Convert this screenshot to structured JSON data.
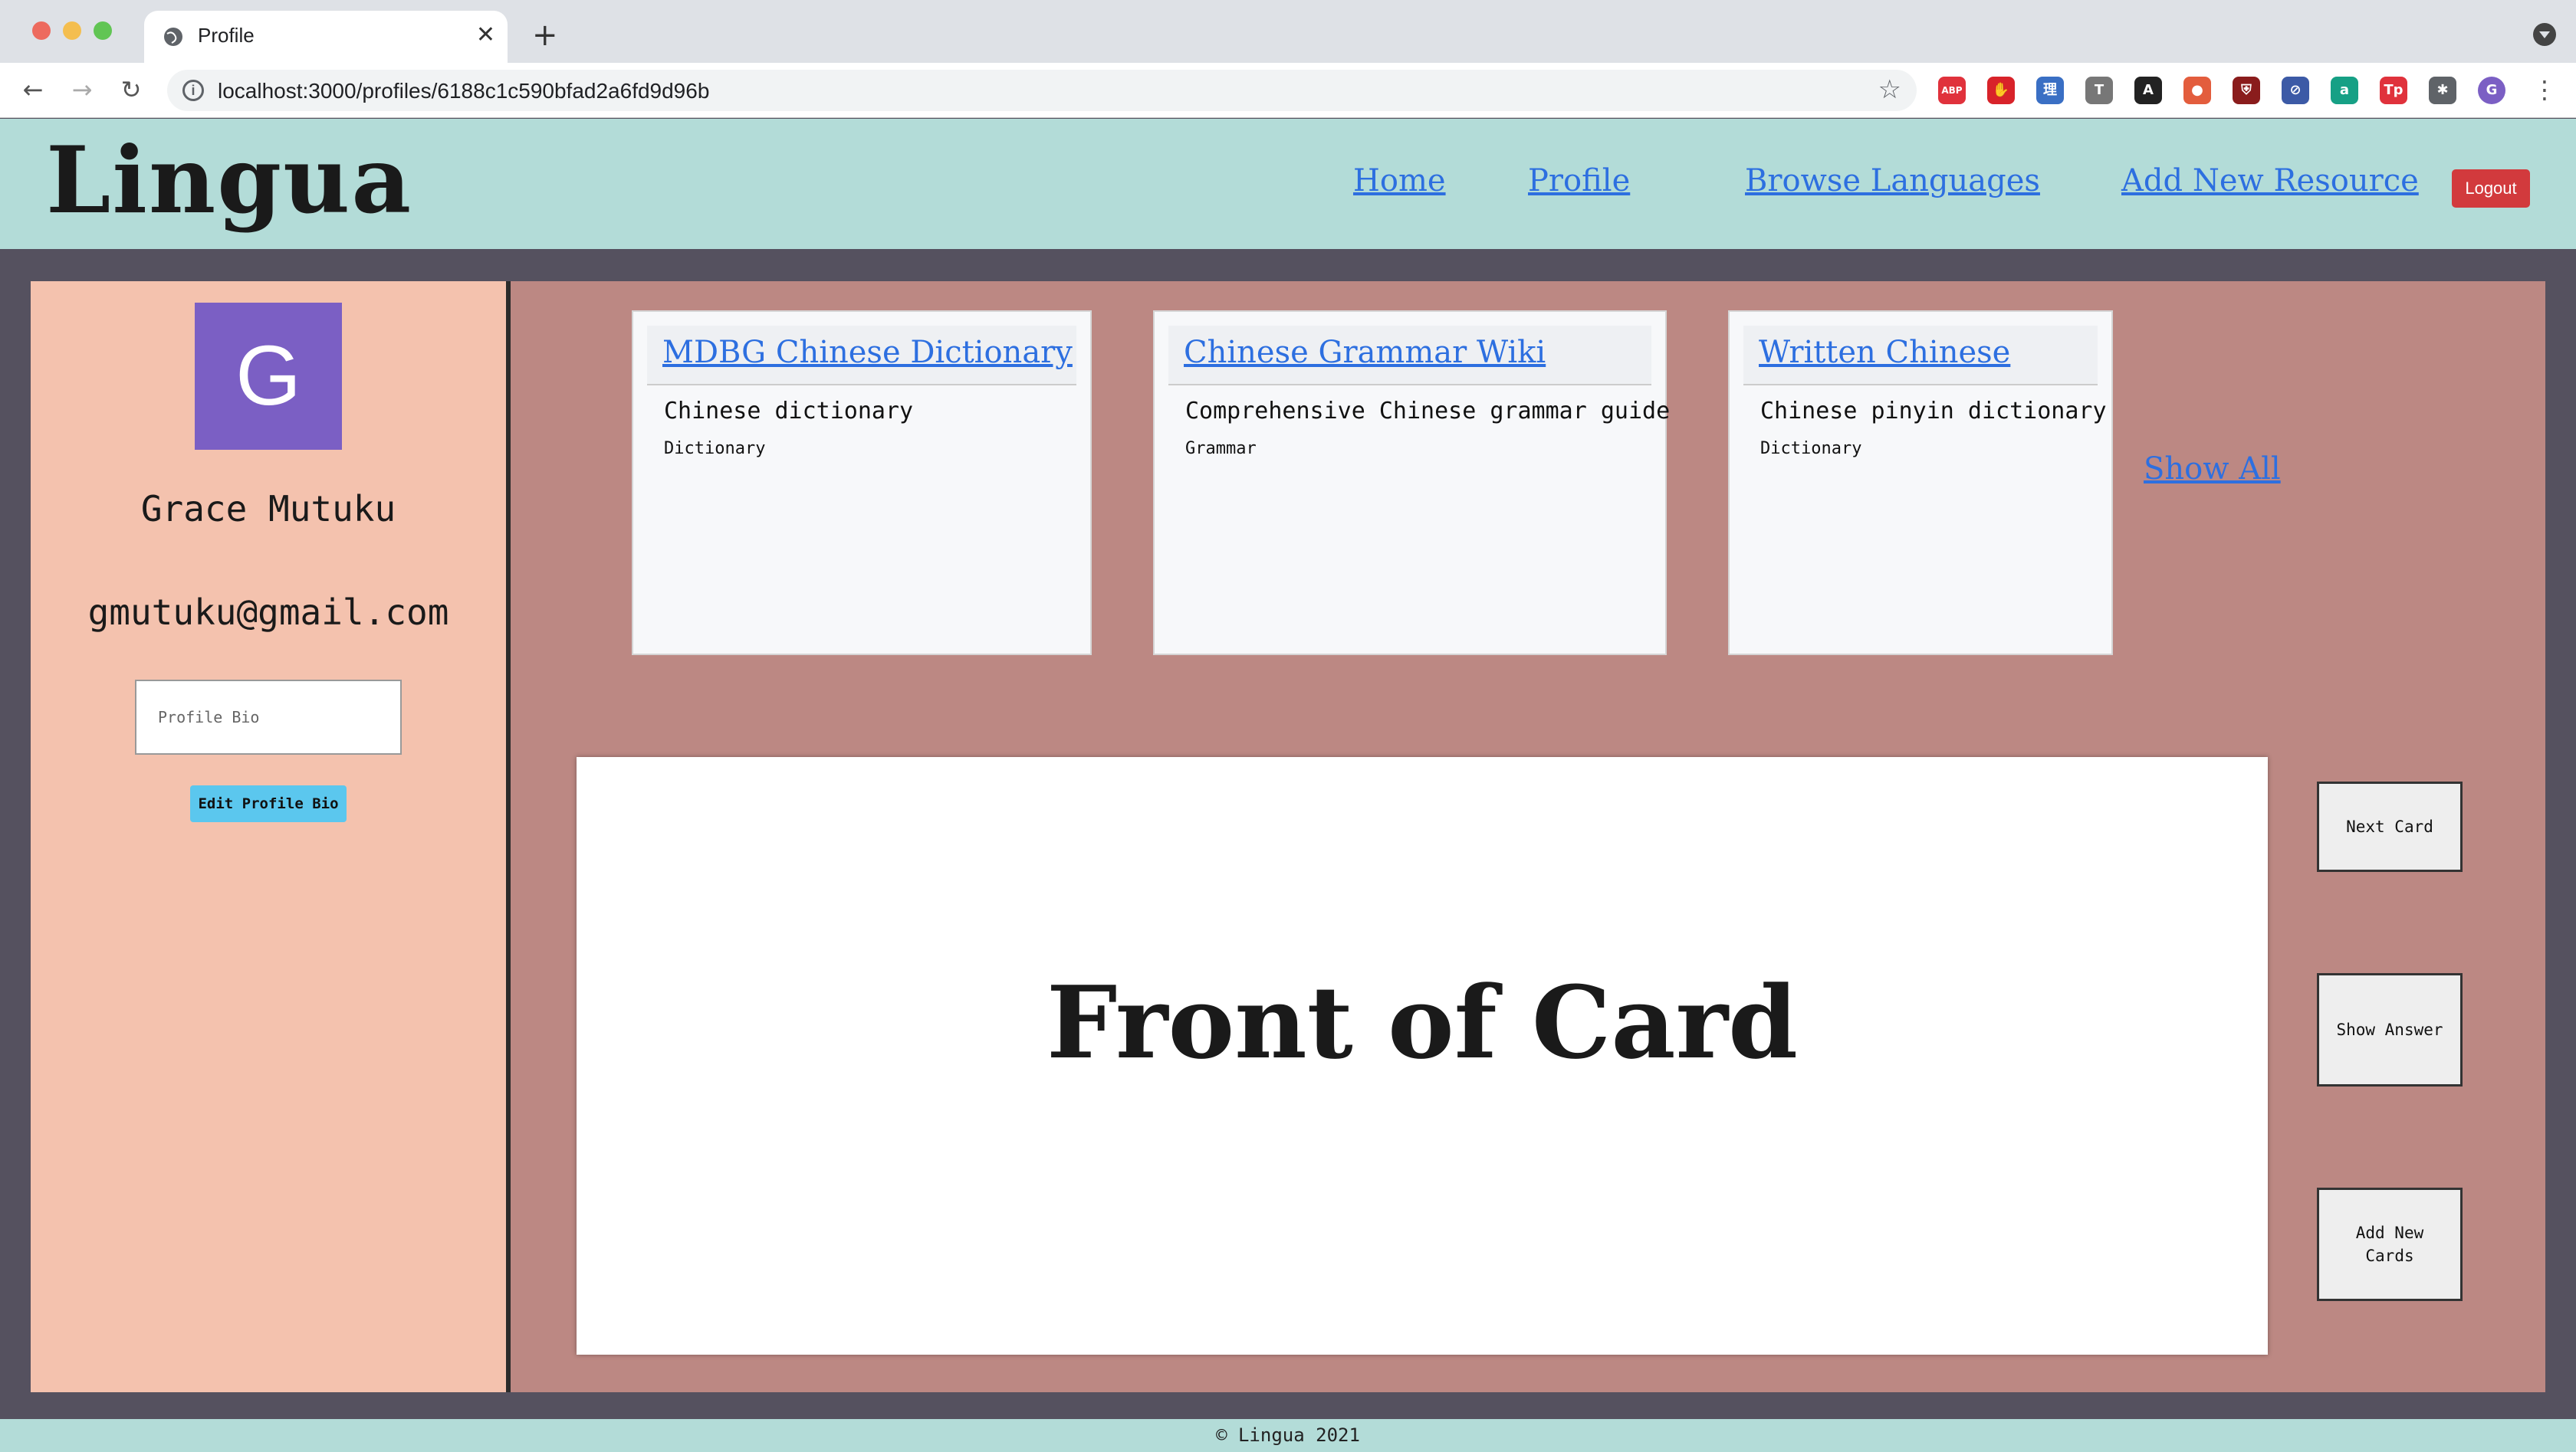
{
  "browser": {
    "tab_title": "Profile",
    "url": "localhost:3000/profiles/6188c1c590bfad2a6fd9d96b",
    "extensions": [
      {
        "name": "adblock-icon",
        "label": "ABP",
        "color": "#e0323c"
      },
      {
        "name": "stop-icon",
        "label": "✋",
        "color": "#d8232a"
      },
      {
        "name": "chinese-icon",
        "label": "理",
        "color": "#3a6fc4"
      },
      {
        "name": "t-icon",
        "label": "T",
        "color": "#777777"
      },
      {
        "name": "a-icon",
        "label": "A",
        "color": "#222222"
      },
      {
        "name": "pomodoro-icon",
        "label": "●",
        "color": "#e35d3d"
      },
      {
        "name": "shield-icon",
        "label": "⛨",
        "color": "#8a1c1c"
      },
      {
        "name": "block-icon",
        "label": "⊘",
        "color": "#3c5aa6"
      },
      {
        "name": "grammarly-icon",
        "label": "a",
        "color": "#16a085"
      },
      {
        "name": "tp-icon",
        "label": "Tp",
        "color": "#e0323c"
      },
      {
        "name": "puzzle-icon",
        "label": "✱",
        "color": "#5f6368"
      },
      {
        "name": "account-icon",
        "label": "G",
        "color": "#7b5fc4"
      }
    ]
  },
  "header": {
    "logo": "Lingua",
    "nav": [
      "Home",
      "Profile",
      "Browse Languages",
      "Add New Resource"
    ],
    "logout_label": "Logout"
  },
  "profile": {
    "avatar_initial": "G",
    "name": "Grace Mutuku",
    "email": "gmutuku@gmail.com",
    "bio_placeholder": "Profile Bio",
    "edit_bio_label": "Edit Profile Bio"
  },
  "resources": [
    {
      "title": "MDBG Chinese Dictionary",
      "description": "Chinese dictionary",
      "category": "Dictionary"
    },
    {
      "title": "Chinese Grammar Wiki",
      "description": "Comprehensive Chinese grammar guide",
      "category": "Grammar"
    },
    {
      "title": "Written Chinese",
      "description": "Chinese pinyin dictionary",
      "category": "Dictionary"
    }
  ],
  "show_all_label": "Show All",
  "flashcard": {
    "front_text": "Front of Card",
    "next_label": "Next Card",
    "show_answer_label": "Show Answer",
    "add_cards_label": "Add New Cards"
  },
  "footer": "© Lingua 2021"
}
